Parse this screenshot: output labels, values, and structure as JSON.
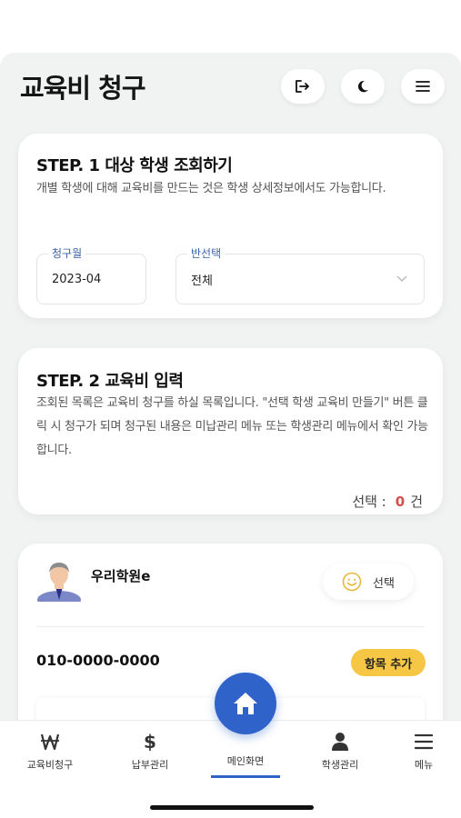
{
  "header": {
    "title": "교육비 청구",
    "buttons": [
      {
        "icon": "logout-icon"
      },
      {
        "icon": "dark-mode-moon-icon"
      },
      {
        "icon": "hamburger-menu-icon"
      }
    ]
  },
  "step1": {
    "title": "STEP. 1 대상 학생 조회하기",
    "description": "개별 학생에 대해 교육비를 만드는 것은 학생 상세정보에서도 가능합니다.",
    "month_label": "청구월",
    "month_value": "2023-04",
    "class_label": "반선택",
    "class_value": "전체"
  },
  "step2": {
    "title": "STEP. 2 교육비 입력",
    "description": "조회된 목록은 교육비 청구를 하실 목록입니다. \"선택 학생 교육비 만들기\" 버튼 클릭 시 청구가 되며 청구된 내용은 미납관리 메뉴 또는 학생관리 메뉴에서 확인 가능합니다.",
    "count_label": "선택 :",
    "count_value": "0",
    "count_unit": "건"
  },
  "student": {
    "name": "우리학원e",
    "select_label": "선택",
    "phone": "010-0000-0000",
    "add_item_label": "항목 추가"
  },
  "nav": {
    "items": [
      {
        "label": "교육비청구",
        "icon": "won-icon"
      },
      {
        "label": "납부관리",
        "icon": "dollar-icon"
      },
      {
        "label": "메인화면",
        "icon": "home-icon"
      },
      {
        "label": "학생관리",
        "icon": "person-icon"
      },
      {
        "label": "메뉴",
        "icon": "menu-icon"
      }
    ]
  },
  "colors": {
    "accent": "#2f63c9",
    "badge": "#f6c744",
    "count": "#d64d4d"
  }
}
